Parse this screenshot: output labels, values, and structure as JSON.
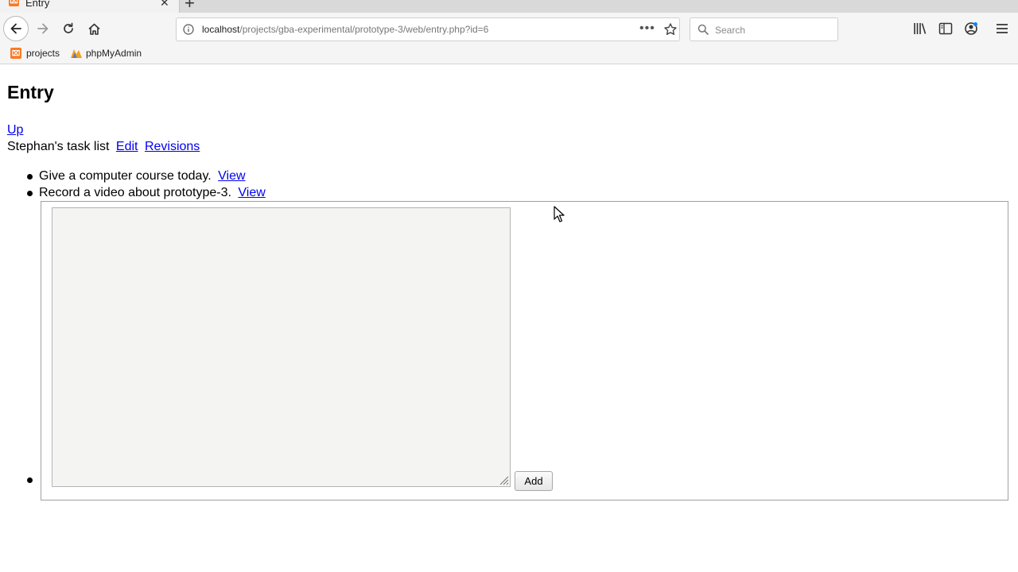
{
  "tab": {
    "title": "Entry",
    "favicon": "xampp-icon"
  },
  "urlbar": {
    "host": "localhost",
    "path": "/projects/gba-experimental/prototype-3/web/entry.php?id=6",
    "more": "•••"
  },
  "search": {
    "placeholder": "Search"
  },
  "bookmarks": [
    {
      "label": "projects",
      "icon": "xampp-icon"
    },
    {
      "label": "phpMyAdmin",
      "icon": "phpmyadmin-icon"
    }
  ],
  "page": {
    "title": "Entry",
    "up_link": "Up",
    "entry_name": "Stephan's task list",
    "edit_link": "Edit",
    "revisions_link": "Revisions",
    "items": [
      {
        "text": "Give a computer course today.",
        "link": "View"
      },
      {
        "text": "Record a video about prototype-3.",
        "link": "View"
      }
    ],
    "new_item": {
      "textarea_value": "",
      "button": "Add"
    }
  },
  "colors": {
    "link": "#0000ee",
    "accent": "#fb7a24"
  }
}
